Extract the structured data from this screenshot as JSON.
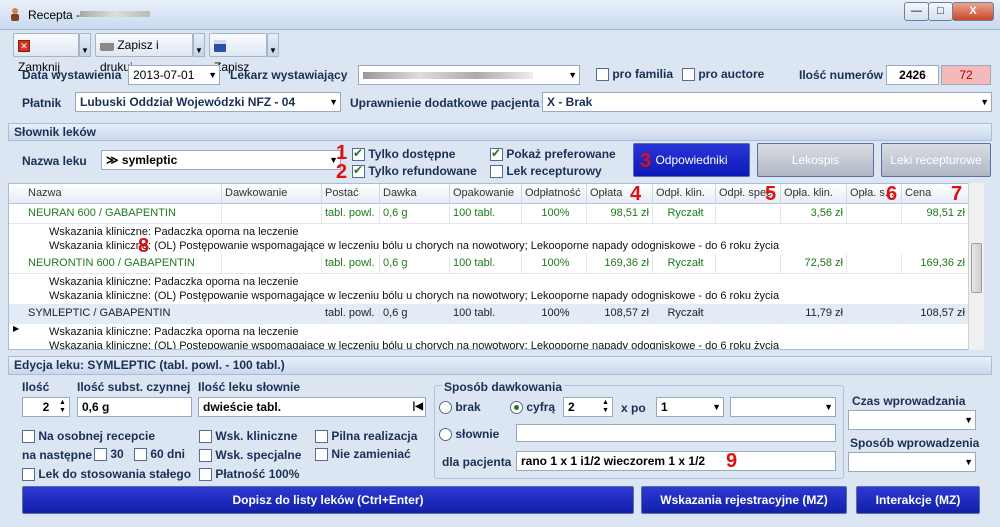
{
  "window": {
    "title": "Recepta -",
    "close_label": "X"
  },
  "toolbar": {
    "close_label": "Zamknij",
    "save_print_label": "Zapisz i drukuj",
    "save_label": "Zapisz"
  },
  "header": {
    "date_label": "Data wystawienia",
    "date_value": "2013-07-01",
    "doctor_label": "Lekarz wystawiający",
    "pro_familia_label": "pro familia",
    "pro_auctore_label": "pro auctore",
    "count_label": "Ilość numerów",
    "count_value": "2426",
    "count_alert": "72",
    "payer_label": "Płatnik",
    "payer_value": "Lubuski Oddział Wojewódzki NFZ - 04",
    "entitlement_label": "Uprawnienie dodatkowe pacjenta",
    "entitlement_value": "X - Brak"
  },
  "drug_dict": {
    "section_title": "Słownik leków",
    "name_label": "Nazwa leku",
    "name_value": "symleptic",
    "only_available": "Tylko dostępne",
    "only_refunded": "Tylko refundowane",
    "show_preferred": "Pokaż preferowane",
    "prescription_drug": "Lek recepturowy",
    "btn_equivalents": "Odpowiedniki",
    "btn_lekospis": "Lekospis",
    "btn_recipe_drugs": "Leki recepturowe"
  },
  "annotations": {
    "a1": "1",
    "a2": "2",
    "a3": "3",
    "a4": "4",
    "a5": "5",
    "a6": "6",
    "a7": "7",
    "a8": "8",
    "a9": "9"
  },
  "grid": {
    "columns": [
      "Nazwa",
      "Dawkowanie",
      "Postać",
      "Dawka",
      "Opakowanie",
      "Odpłatność",
      "Opłata",
      "Odpł. klin.",
      "Odpł. spec.",
      "Opła. klin.",
      "Opła. s...",
      "Cena"
    ],
    "rows": [
      {
        "name": "NEURAN 600 / GABAPENTIN",
        "form": "tabl. powl.",
        "dose": "0,6 g",
        "pack": "100 tabl.",
        "refund": "100%",
        "fee": "98,51 zł",
        "klin": "Ryczałt",
        "spec": "",
        "fee_klin": "3,56 zł",
        "fee_spec": "",
        "price": "98,51 zł",
        "ind1": "Wskazania kliniczne: Padaczka oporna na leczenie",
        "ind2": "Wskazania kliniczne:  (OL) Postępowanie wspomagające w leczeniu bólu u chorych na nowotwory; Lekooporne napady odogniskowe - do 6 roku życia"
      },
      {
        "name": "NEURONTIN 600 / GABAPENTIN",
        "form": "tabl. powl.",
        "dose": "0,6 g",
        "pack": "100 tabl.",
        "refund": "100%",
        "fee": "169,36 zł",
        "klin": "Ryczałt",
        "spec": "",
        "fee_klin": "72,58 zł",
        "fee_spec": "",
        "price": "169,36 zł",
        "ind1": "Wskazania kliniczne: Padaczka oporna na leczenie",
        "ind2": "Wskazania kliniczne:  (OL) Postępowanie wspomagające w leczeniu bólu u chorych na nowotwory; Lekooporne napady odogniskowe - do 6 roku życia"
      },
      {
        "name": "SYMLEPTIC / GABAPENTIN",
        "form": "tabl. powl.",
        "dose": "0,6 g",
        "pack": "100 tabl.",
        "refund": "100%",
        "fee": "108,57 zł",
        "klin": "Ryczałt",
        "spec": "",
        "fee_klin": "11,79 zł",
        "fee_spec": "",
        "price": "108,57 zł",
        "ind1": "Wskazania kliniczne: Padaczka oporna na leczenie",
        "ind2": "Wskazania kliniczne:  (OL) Postępowanie wspomagające w leczeniu bólu u chorych na nowotwory; Lekooporne napady odogniskowe - do 6 roku życia"
      }
    ]
  },
  "edit": {
    "section_title": "Edycja leku: SYMLEPTIC (tabl. powl. - 100 tabl.)",
    "qty_label": "Ilość",
    "qty_value": "2",
    "active_label": "Ilość subst. czynnej",
    "active_value": "0,6 g",
    "words_label": "Ilość leku słownie",
    "words_value": "dwieście  tabl.",
    "separate_rx": "Na osobnej recepcie",
    "next_label": "na następne",
    "d30": "30",
    "d60": "60 dni",
    "permanent": "Lek do stosowania stałego",
    "ind_clinical": "Wsk. kliniczne",
    "ind_special": "Wsk. specjalne",
    "pay100": "Płatność 100%",
    "urgent": "Pilna realizacja",
    "no_substitute": "Nie zamieniać",
    "dosing_title": "Sposób dawkowania",
    "opt_none": "brak",
    "opt_number": "cyfrą",
    "opt_words": "słownie",
    "dose_num": "2",
    "per_label": "x po",
    "per_value": "1",
    "patient_label": "dla pacjenta",
    "patient_value": "rano 1 x 1 i1/2  wieczorem 1 x 1/2",
    "time_label": "Czas wprowadzania",
    "method_label": "Sposób wprowadzenia"
  },
  "footer": {
    "add_label": "Dopisz do listy leków (Ctrl+Enter)",
    "reg_label": "Wskazania rejestracyjne (MZ)",
    "interact_label": "Interakcje (MZ)"
  }
}
